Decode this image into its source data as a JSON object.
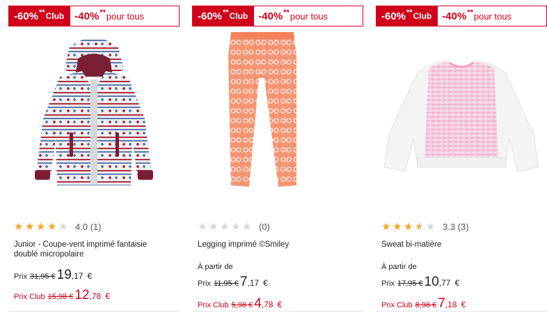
{
  "badge": {
    "club_percent": "-60%",
    "club_star": "**",
    "club_label": "Club",
    "all_percent": "-40%",
    "all_star": "**",
    "all_label": "pour tous"
  },
  "colors": {
    "accent": "#d0021b",
    "star": "#f5a623",
    "star_empty": "#d6d6d6"
  },
  "products": [
    {
      "image": "hooded-jacket-patterned-image",
      "rating_value": 4.0,
      "rating_text": "4.0 (1)",
      "name": "Junior - Coupe-vent imprimé fantaisie doublé micropolaire",
      "from_label": "",
      "price_label": "Prix",
      "price_old": "31,95 €",
      "price_int": "19",
      "price_dec": ",17",
      "price_cur": "€",
      "club_label": "Prix Club",
      "club_old": "15,98 €",
      "club_int": "12",
      "club_dec": ",78",
      "club_cur": "€"
    },
    {
      "image": "orange-legging-image",
      "rating_value": 0,
      "rating_text": "(0)",
      "name": "Legging imprimé ©Smiley",
      "from_label": "À partir de",
      "price_label": "Prix",
      "price_old": "11,95 €",
      "price_int": "7",
      "price_dec": ",17",
      "price_cur": "€",
      "club_label": "Prix Club",
      "club_old": "5,98 €",
      "club_int": "4",
      "club_dec": ",78",
      "club_cur": "€"
    },
    {
      "image": "pink-sweatshirt-image",
      "rating_value": 3.3,
      "rating_text": "3.3 (3)",
      "name": "Sweat bi-matière",
      "from_label": "À partir de",
      "price_label": "Prix",
      "price_old": "17,95 €",
      "price_int": "10",
      "price_dec": ",77",
      "price_cur": "€",
      "club_label": "Prix Club",
      "club_old": "8,98 €",
      "club_int": "7",
      "club_dec": ",18",
      "club_cur": "€"
    }
  ]
}
